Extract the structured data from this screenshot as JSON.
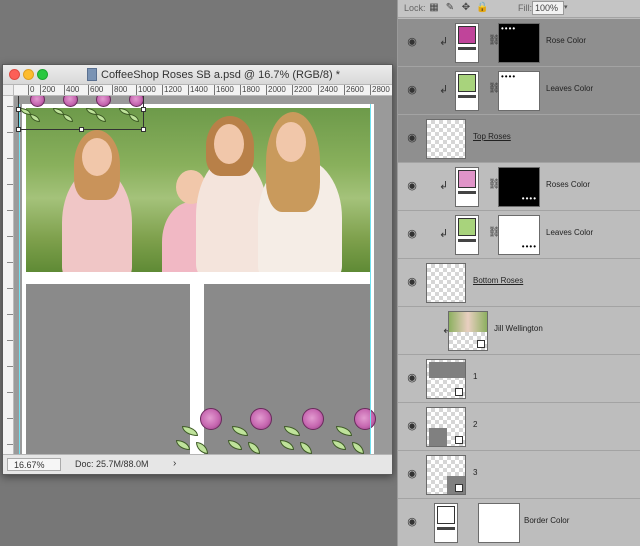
{
  "document": {
    "title": "CoffeeShop Roses SB a.psd @ 16.7% (RGB/8) *",
    "ruler_labels": [
      "0",
      "200",
      "400",
      "600",
      "800",
      "1000",
      "1200",
      "1400",
      "1600",
      "1800",
      "2000",
      "2200",
      "2400",
      "2600",
      "2800"
    ],
    "zoom": "16.67%",
    "doc_info": "Doc: 25.7M/88.0M",
    "status_arrow": "›"
  },
  "layers_toolbar": {
    "lock_label": "Lock:",
    "fill_label": "Fill:",
    "fill_value": "100%",
    "icons": [
      "transparency-lock-icon",
      "brush-lock-icon",
      "move-lock-icon",
      "padlock-icon"
    ]
  },
  "layers": [
    {
      "name": "Rose Color",
      "type": "fill",
      "swatch": "#c0449a",
      "mask": "black",
      "clipped": true,
      "selected": true
    },
    {
      "name": "Leaves Color",
      "type": "fill",
      "swatch": "#a8d37c",
      "mask": "white",
      "clipped": true,
      "selected": true
    },
    {
      "name": "Top Roses",
      "type": "pixel",
      "clipped": false,
      "selected": true
    },
    {
      "name": "Roses Color",
      "type": "fill",
      "swatch": "#e094c8",
      "mask": "black",
      "clipped": true,
      "selected": false
    },
    {
      "name": "Leaves Color",
      "type": "fill",
      "swatch": "#a8d37c",
      "mask": "white",
      "clipped": true,
      "selected": false
    },
    {
      "name": "Bottom Roses",
      "type": "pixel",
      "clipped": false,
      "selected": false
    },
    {
      "name": "Jill Wellington",
      "type": "photo",
      "clipped": true,
      "selected": false
    },
    {
      "name": "1",
      "type": "shape",
      "clipped": false,
      "selected": false
    },
    {
      "name": "2",
      "type": "shape",
      "clipped": false,
      "selected": false
    },
    {
      "name": "3",
      "type": "shape",
      "clipped": false,
      "selected": false
    },
    {
      "name": "Border Color",
      "type": "fill",
      "swatch": "#ffffff",
      "mask": "white",
      "clipped": false,
      "selected": false
    }
  ],
  "colors": {
    "app_background": "#777777",
    "panel": "#bcbcbc",
    "selected_row": "#8f8f8f",
    "rose": "#c768b1",
    "leaf": "#bfe39b",
    "frame_grey": "#8a8a8a"
  }
}
